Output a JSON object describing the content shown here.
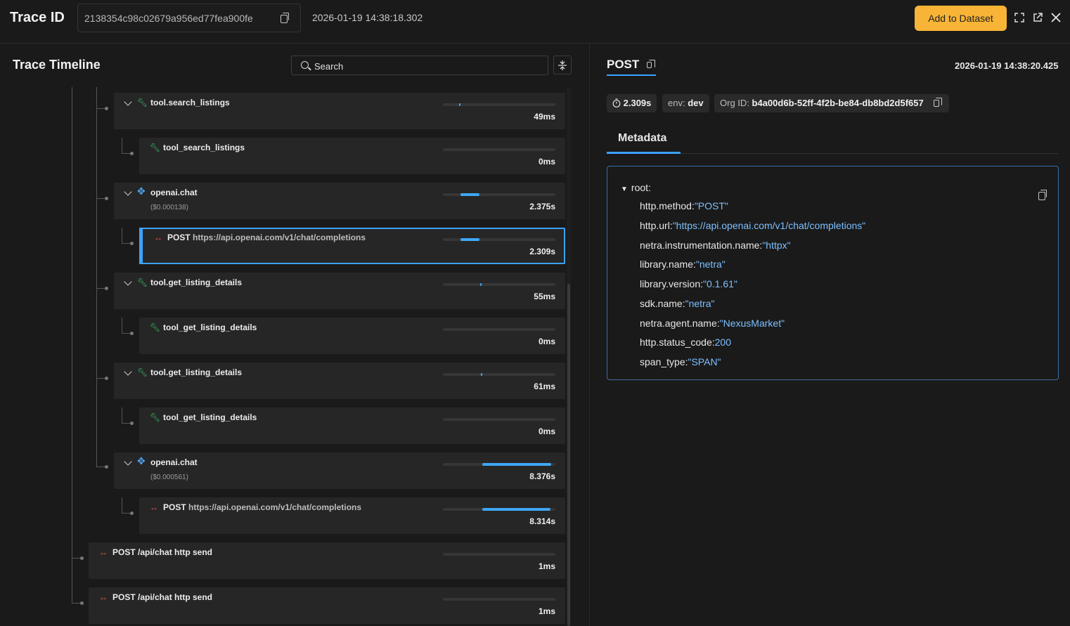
{
  "header": {
    "title": "Trace ID",
    "trace_id": "2138354c98c02679a956ed77fea900fe",
    "timestamp": "2026-01-19 14:38:18.302",
    "add_button": "Add to Dataset"
  },
  "left": {
    "title": "Trace Timeline",
    "search_placeholder": "Search",
    "spans": [
      {
        "name": "tool.search_listings",
        "url": "",
        "cost": "",
        "duration": "49ms",
        "kind": "tool",
        "bar_start": 0.145,
        "bar_width": 0.008
      },
      {
        "name": "tool_search_listings",
        "url": "",
        "cost": "",
        "duration": "0ms",
        "kind": "tool",
        "bar_start": 0,
        "bar_width": 0
      },
      {
        "name": "openai.chat",
        "url": "",
        "cost": "($0.000138)",
        "duration": "2.375s",
        "kind": "llm",
        "bar_start": 0.155,
        "bar_width": 0.17
      },
      {
        "name": "POST",
        "url": "https://api.openai.com/v1/chat/completions",
        "cost": "",
        "duration": "2.309s",
        "kind": "http",
        "bar_start": 0.155,
        "bar_width": 0.17
      },
      {
        "name": "tool.get_listing_details",
        "url": "",
        "cost": "",
        "duration": "55ms",
        "kind": "tool",
        "bar_start": 0.33,
        "bar_width": 0.008
      },
      {
        "name": "tool_get_listing_details",
        "url": "",
        "cost": "",
        "duration": "0ms",
        "kind": "tool",
        "bar_start": 0,
        "bar_width": 0
      },
      {
        "name": "tool.get_listing_details",
        "url": "",
        "cost": "",
        "duration": "61ms",
        "kind": "tool",
        "bar_start": 0.335,
        "bar_width": 0.008
      },
      {
        "name": "tool_get_listing_details",
        "url": "",
        "cost": "",
        "duration": "0ms",
        "kind": "tool",
        "bar_start": 0,
        "bar_width": 0
      },
      {
        "name": "openai.chat",
        "url": "",
        "cost": "($0.000561)",
        "duration": "8.376s",
        "kind": "llm",
        "bar_start": 0.35,
        "bar_width": 0.615
      },
      {
        "name": "POST",
        "url": "https://api.openai.com/v1/chat/completions",
        "cost": "",
        "duration": "8.314s",
        "kind": "http",
        "bar_start": 0.35,
        "bar_width": 0.605
      },
      {
        "name": "POST /api/chat http send",
        "url": "",
        "cost": "",
        "duration": "1ms",
        "kind": "http",
        "bar_start": 0,
        "bar_width": 0
      },
      {
        "name": "POST /api/chat http send",
        "url": "",
        "cost": "",
        "duration": "1ms",
        "kind": "http",
        "bar_start": 0,
        "bar_width": 0
      }
    ]
  },
  "right": {
    "title": "POST",
    "timestamp": "2026-01-19 14:38:20.425",
    "duration": "2.309s",
    "env_label": "env:",
    "env_value": "dev",
    "org_label": "Org ID:",
    "org_value": "b4a00d6b-52ff-4f2b-be84-db8bd2d5f657",
    "tab": "Metadata",
    "root_label": "root:",
    "metadata": [
      {
        "key": "http.method:",
        "value": "\"POST\""
      },
      {
        "key": "http.url:",
        "value": "\"https://api.openai.com/v1/chat/completions\""
      },
      {
        "key": "netra.instrumentation.name:",
        "value": "\"httpx\""
      },
      {
        "key": "library.name:",
        "value": "\"netra\""
      },
      {
        "key": "library.version:",
        "value": "\"0.1.61\""
      },
      {
        "key": "sdk.name:",
        "value": "\"netra\""
      },
      {
        "key": "netra.agent.name:",
        "value": "\"NexusMarket\""
      },
      {
        "key": "http.status_code:",
        "value": "200"
      },
      {
        "key": "span_type:",
        "value": "\"SPAN\""
      }
    ]
  },
  "colors": {
    "accent": "#3aa3ff",
    "button": "#f7b436",
    "tool_icon": "#3ec46d",
    "http_icon": "#f05252"
  }
}
